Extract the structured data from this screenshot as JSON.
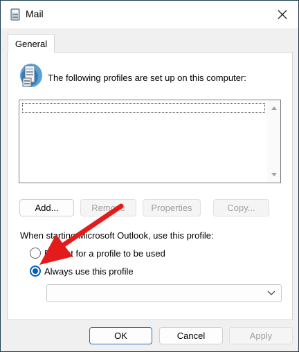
{
  "window": {
    "title": "Mail"
  },
  "tabs": [
    {
      "label": "General"
    }
  ],
  "profiles": {
    "heading": "The following profiles are set up on this computer:",
    "items": []
  },
  "buttons": {
    "add": "Add...",
    "remove": "Remove",
    "properties": "Properties",
    "copy": "Copy...",
    "ok": "OK",
    "cancel": "Cancel",
    "apply": "Apply"
  },
  "startup": {
    "label": "When starting Microsoft Outlook, use this profile:",
    "options": [
      {
        "label": "Prompt for a profile to be used",
        "checked": false
      },
      {
        "label": "Always use this profile",
        "checked": true
      }
    ],
    "selected_profile": ""
  },
  "colors": {
    "accent": "#005fb8",
    "annotation_arrow": "#e31b1b"
  },
  "icons": [
    "mail-icon",
    "close-icon",
    "profiles-icon",
    "chevron-up-icon",
    "chevron-down-icon",
    "arrow-annotation"
  ]
}
